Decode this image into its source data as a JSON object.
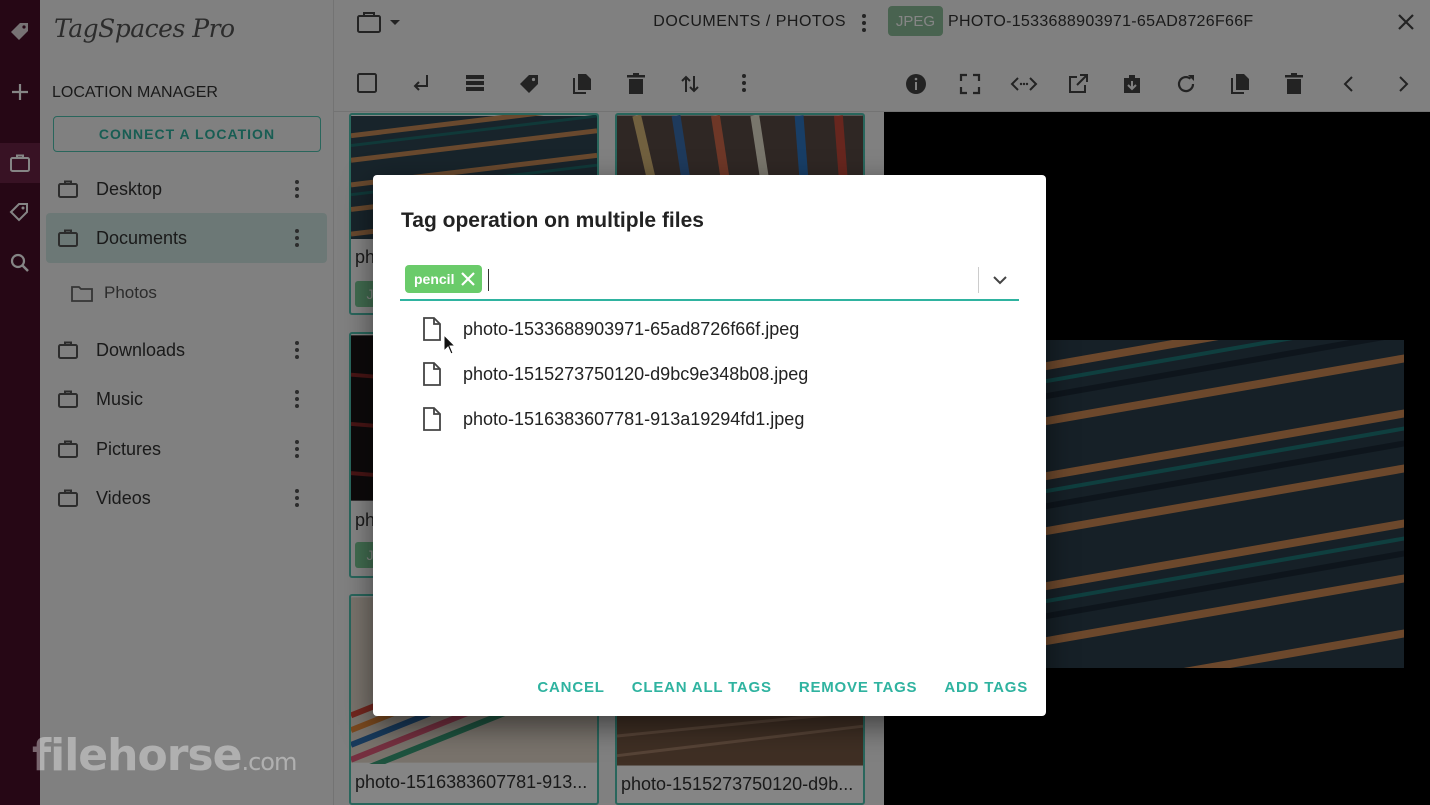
{
  "app": {
    "logo_text": "TagSpaces Pro",
    "accent_color": "#2fb3a0"
  },
  "rail": {
    "icons": [
      "tag-logo-icon",
      "plus-icon",
      "briefcase-icon",
      "tags-icon",
      "search-icon"
    ]
  },
  "sidebar": {
    "title": "LOCATION MANAGER",
    "connect_label": "CONNECT A LOCATION",
    "locations": [
      {
        "label": "Desktop"
      },
      {
        "label": "Documents"
      },
      {
        "label": "Downloads"
      },
      {
        "label": "Music"
      },
      {
        "label": "Pictures"
      },
      {
        "label": "Videos"
      }
    ],
    "subfolder": "Photos"
  },
  "filelist": {
    "breadcrumb": "DOCUMENTS / PHOTOS",
    "captions": [
      "ph",
      "ph",
      "photo-1516383607781-913...",
      "photo-1515273750120-d9b..."
    ],
    "tag_letter": "J",
    "toolbar_icons": [
      "select-all-icon",
      "parent-folder-icon",
      "list-view-icon",
      "tag-icon",
      "copy-icon",
      "delete-icon",
      "sort-icon",
      "more-icon"
    ]
  },
  "preview": {
    "type_badge": "JPEG",
    "file_title": "PHOTO-1533688903971-65AD8726F66F",
    "toolbar_icons": [
      "info-icon",
      "fullscreen-icon",
      "code-icon",
      "open-external-icon",
      "download-icon",
      "reload-icon",
      "copy-icon",
      "delete-icon",
      "previous-icon",
      "next-icon"
    ]
  },
  "dialog": {
    "title": "Tag operation on multiple files",
    "tag_chip": "pencil",
    "files": [
      "photo-1533688903971-65ad8726f66f.jpeg",
      "photo-1515273750120-d9bc9e348b08.jpeg",
      "photo-1516383607781-913a19294fd1.jpeg"
    ],
    "buttons": {
      "cancel": "CANCEL",
      "clean": "CLEAN ALL TAGS",
      "remove": "REMOVE TAGS",
      "add": "ADD TAGS"
    }
  },
  "watermark": {
    "main": "filehorse",
    "suffix": ".com"
  }
}
